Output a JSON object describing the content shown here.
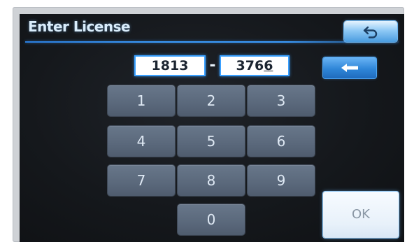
{
  "screen": {
    "title": "Enter License"
  },
  "license": {
    "part1": "1813",
    "separator": "-",
    "part2": "376",
    "part2_cursor_char": "6"
  },
  "keypad": {
    "keys": [
      "1",
      "2",
      "3",
      "4",
      "5",
      "6",
      "7",
      "8",
      "9",
      "0"
    ]
  },
  "actions": {
    "ok_label": "OK"
  },
  "icons": {
    "back": "return-arrow-icon",
    "backspace": "backspace-arrow-icon"
  },
  "colors": {
    "accent": "#3aa0ff",
    "key_bg": "#5a687b",
    "screen_bg": "#15181c"
  }
}
